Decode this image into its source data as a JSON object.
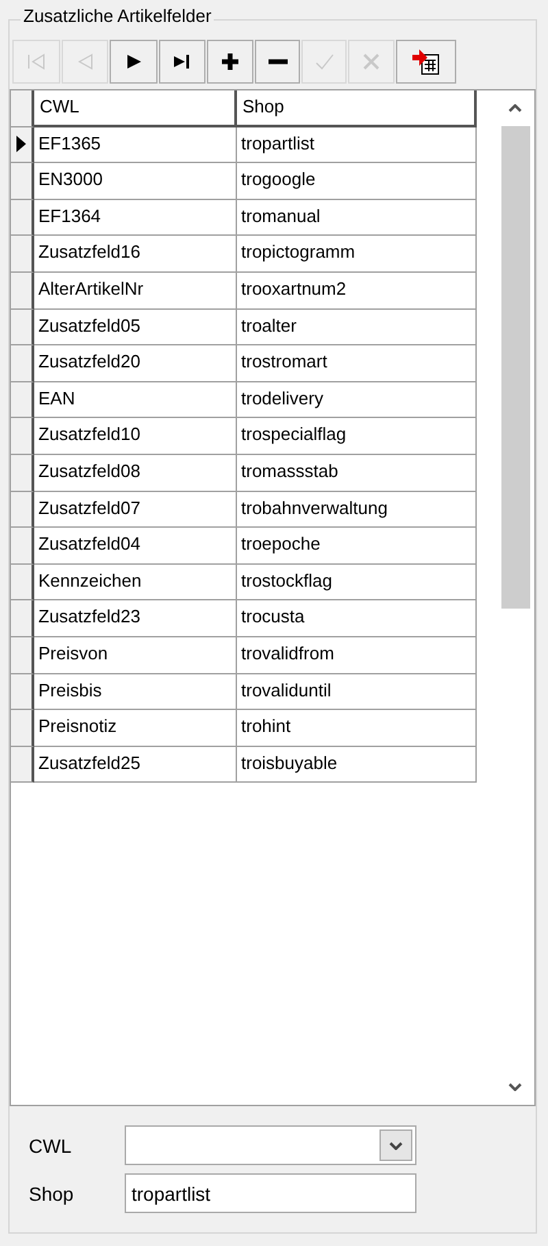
{
  "group": {
    "title": "Zusatzliche Artikelfelder"
  },
  "toolbar": [
    {
      "kind": "first",
      "disabled": true
    },
    {
      "kind": "prior",
      "disabled": true
    },
    {
      "kind": "next",
      "disabled": false
    },
    {
      "kind": "last",
      "disabled": false
    },
    {
      "kind": "insert",
      "disabled": false
    },
    {
      "kind": "delete",
      "disabled": false
    },
    {
      "kind": "post",
      "disabled": true
    },
    {
      "kind": "cancel",
      "disabled": true
    },
    {
      "kind": "export",
      "disabled": false
    }
  ],
  "table": {
    "columns": [
      "CWL",
      "Shop"
    ],
    "rows": [
      {
        "cwl": "EF1365",
        "shop": "tropartlist",
        "selected": true
      },
      {
        "cwl": "EN3000",
        "shop": "trogoogle",
        "selected": false
      },
      {
        "cwl": "EF1364",
        "shop": "tromanual",
        "selected": false
      },
      {
        "cwl": "Zusatzfeld16",
        "shop": "tropictogramm",
        "selected": false
      },
      {
        "cwl": "AlterArtikelNr",
        "shop": "trooxartnum2",
        "selected": false
      },
      {
        "cwl": "Zusatzfeld05",
        "shop": "troalter",
        "selected": false
      },
      {
        "cwl": "Zusatzfeld20",
        "shop": "trostromart",
        "selected": false
      },
      {
        "cwl": "EAN",
        "shop": "trodelivery",
        "selected": false
      },
      {
        "cwl": "Zusatzfeld10",
        "shop": "trospecialflag",
        "selected": false
      },
      {
        "cwl": "Zusatzfeld08",
        "shop": "tromassstab",
        "selected": false
      },
      {
        "cwl": "Zusatzfeld07",
        "shop": "trobahnverwaltung",
        "selected": false
      },
      {
        "cwl": "Zusatzfeld04",
        "shop": "troepoche",
        "selected": false
      },
      {
        "cwl": "Kennzeichen",
        "shop": "trostockflag",
        "selected": false
      },
      {
        "cwl": "Zusatzfeld23",
        "shop": "trocusta",
        "selected": false
      },
      {
        "cwl": "Preisvon",
        "shop": "trovalidfrom",
        "selected": false
      },
      {
        "cwl": "Preisbis",
        "shop": "trovaliduntil",
        "selected": false
      },
      {
        "cwl": "Preisnotiz",
        "shop": "trohint",
        "selected": false
      },
      {
        "cwl": "Zusatzfeld25",
        "shop": "troisbuyable",
        "selected": false
      }
    ]
  },
  "form": {
    "cwl": {
      "label": "CWL"
    },
    "shop": {
      "label": "Shop",
      "value": "tropartlist"
    }
  }
}
